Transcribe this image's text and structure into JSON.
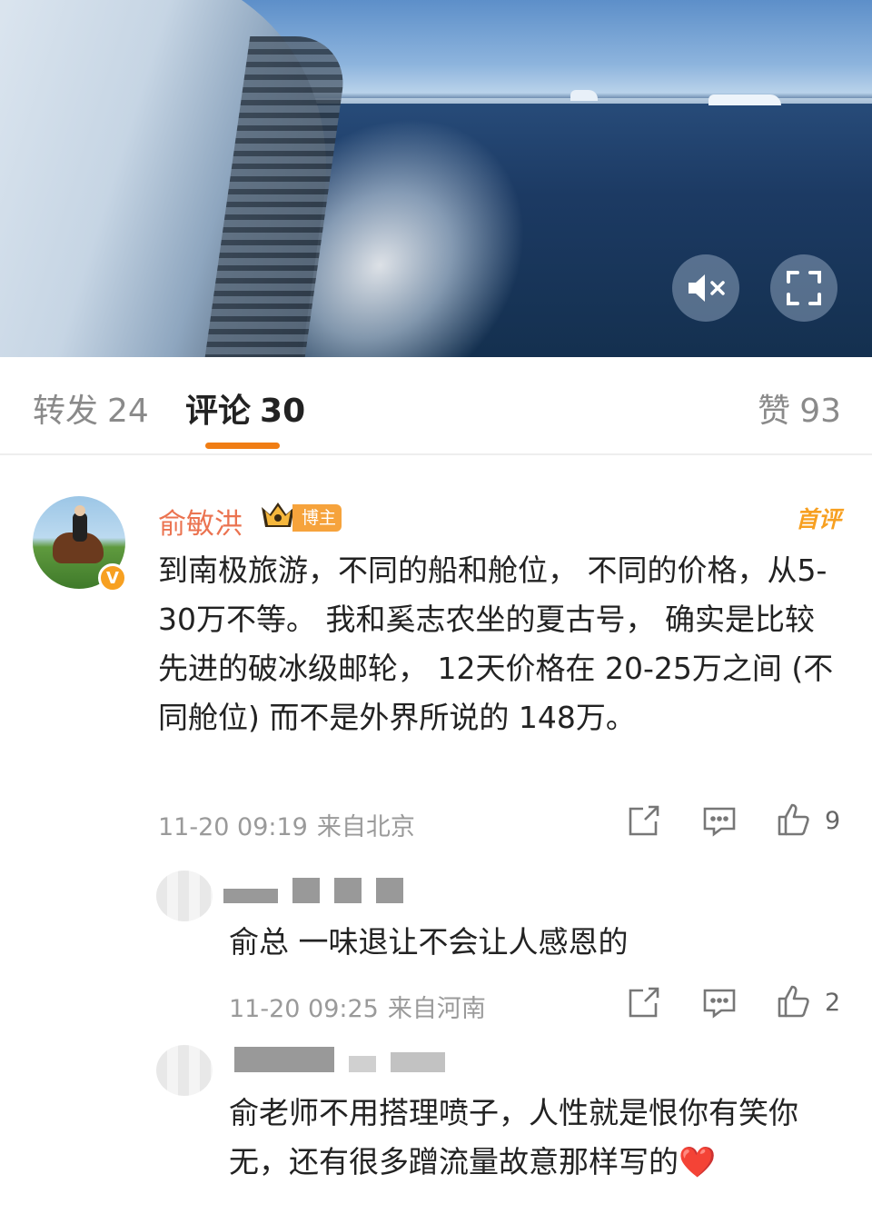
{
  "video": {
    "mute_icon": "mute-icon",
    "fullscreen_icon": "fullscreen-icon"
  },
  "tabs": {
    "repost": {
      "label": "转发",
      "count": "24"
    },
    "comment": {
      "label": "评论",
      "count": "30"
    },
    "like": {
      "label": "赞",
      "count": "93"
    }
  },
  "comments": [
    {
      "username": "俞敏洪",
      "role_tag": "博主",
      "first_comment_tag": "首评",
      "verified": "V",
      "text": "到南极旅游，不同的船和舱位， 不同的价格，从5-30万不等。 我和奚志农坐的夏古号， 确实是比较先进的破冰级邮轮， 12天价格在 20-25万之间 (不同舱位) 而不是外界所说的 148万。",
      "time": "11-20 09:19",
      "location": "来自北京",
      "likes": "9"
    },
    {
      "text": "俞总 一味退让不会让人感恩的",
      "time": "11-20 09:25",
      "location": "来自河南",
      "likes": "2"
    },
    {
      "text": "俞老师不用搭理喷子，人性就是恨你有笑你无，还有很多蹭流量故意那样写的",
      "emoji": "❤️"
    }
  ]
}
